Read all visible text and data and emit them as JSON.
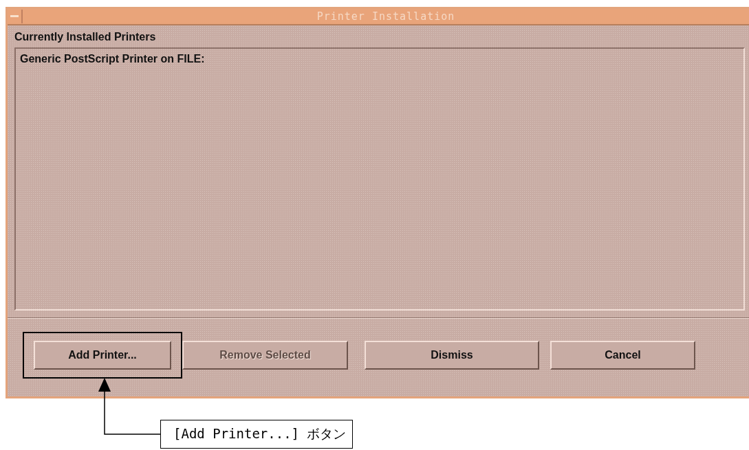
{
  "window": {
    "title": "Printer Installation"
  },
  "installed_label": "Currently Installed Printers",
  "printers": [
    {
      "label": "Generic PostScript Printer on FILE:",
      "selected": false
    }
  ],
  "buttons": [
    {
      "label": "Add Printer...",
      "disabled": false,
      "focused": true
    },
    {
      "label": "Remove Selected",
      "disabled": true,
      "focused": false
    },
    {
      "label": "Dismiss",
      "disabled": false,
      "focused": false
    },
    {
      "label": "Cancel",
      "disabled": false,
      "focused": false
    }
  ],
  "callout": {
    "text": "[Add Printer...] ボタン"
  }
}
